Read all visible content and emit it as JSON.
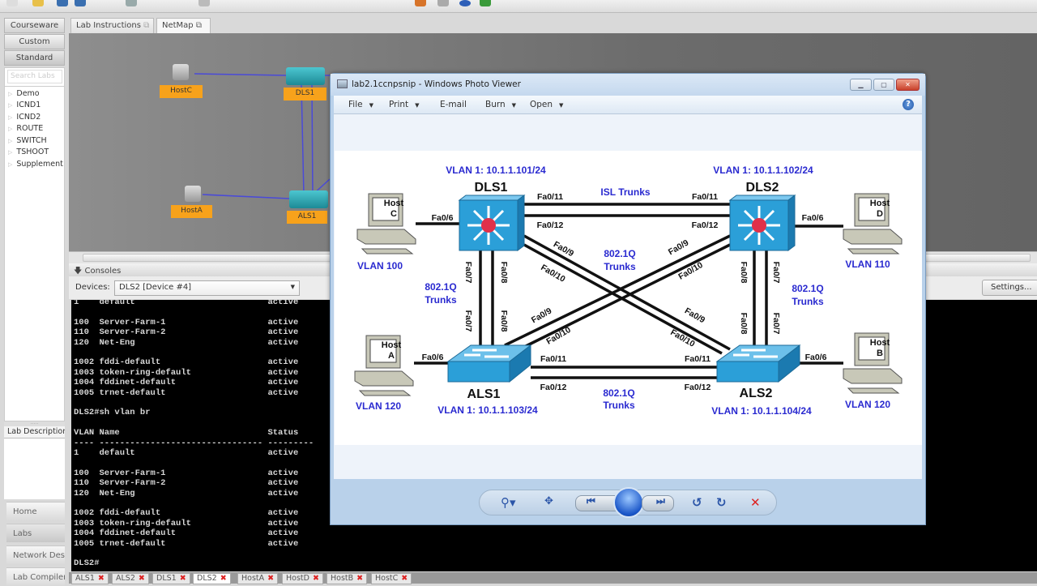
{
  "left_panel": {
    "buttons": [
      "Courseware",
      "Custom",
      "Standard"
    ],
    "search_placeholder": "Search Labs",
    "tree": [
      "Demo",
      "ICND1",
      "ICND2",
      "ROUTE",
      "SWITCH",
      "TSHOOT",
      "Supplement"
    ],
    "description_tab": "Lab Description",
    "nav": [
      "Home",
      "Labs",
      "Network Des",
      "Lab Compiler"
    ]
  },
  "main": {
    "tabs": [
      "Lab Instructions",
      "NetMap"
    ],
    "netmap_nodes": [
      "HostC",
      "DLS1",
      "HostA",
      "ALS1"
    ],
    "consoles_label": "Consoles",
    "devices_label": "Devices:",
    "device_selected": "DLS2 [Device #4]",
    "settings_label": "Settings...",
    "terminal_lines": [
      "1    default                          active",
      "",
      "100  Server-Farm-1                    active",
      "110  Server-Farm-2                    active",
      "120  Net-Eng                          active",
      "",
      "1002 fddi-default                     active",
      "1003 token-ring-default               active",
      "1004 fddinet-default                  active",
      "1005 trnet-default                    active",
      "",
      "DLS2#sh vlan br",
      "",
      "VLAN Name                             Status",
      "---- -------------------------------- ---------",
      "1    default                          active",
      "",
      "100  Server-Farm-1                    active",
      "110  Server-Farm-2                    active",
      "120  Net-Eng                          active",
      "",
      "1002 fddi-default                     active",
      "1003 token-ring-default               active",
      "1004 fddinet-default                  active",
      "1005 trnet-default                    active",
      "",
      "DLS2#"
    ],
    "console_tabs": [
      {
        "label": "ALS1",
        "active": false
      },
      {
        "label": "ALS2",
        "active": false
      },
      {
        "label": "DLS1",
        "active": false
      },
      {
        "label": "DLS2",
        "active": true
      },
      {
        "label": "HostA",
        "active": false
      },
      {
        "label": "HostD",
        "active": false
      },
      {
        "label": "HostB",
        "active": false
      },
      {
        "label": "HostC",
        "active": false
      }
    ]
  },
  "photo_viewer": {
    "title": "lab2.1ccnpsnip - Windows Photo Viewer",
    "menu": [
      {
        "label": "File",
        "dropdown": true
      },
      {
        "label": "Print",
        "dropdown": true
      },
      {
        "label": "E-mail",
        "dropdown": false
      },
      {
        "label": "Burn",
        "dropdown": true
      },
      {
        "label": "Open",
        "dropdown": true
      }
    ],
    "diagram": {
      "dls1": {
        "name": "DLS1",
        "ip": "VLAN 1: 10.1.1.101/24"
      },
      "dls2": {
        "name": "DLS2",
        "ip": "VLAN 1: 10.1.1.102/24"
      },
      "als1": {
        "name": "ALS1",
        "ip": "VLAN 1: 10.1.1.103/24"
      },
      "als2": {
        "name": "ALS2",
        "ip": "VLAN 1: 10.1.1.104/24"
      },
      "hosts": [
        {
          "name": "Host",
          "letter": "C",
          "vlan": "VLAN 100"
        },
        {
          "name": "Host",
          "letter": "D",
          "vlan": "VLAN 110"
        },
        {
          "name": "Host",
          "letter": "A",
          "vlan": "VLAN 120"
        },
        {
          "name": "Host",
          "letter": "B",
          "vlan": "VLAN 120"
        }
      ],
      "isl_trunks": "ISL Trunks",
      "dot1q": "802.1Q",
      "trunks": "Trunks",
      "ports": {
        "fa6": "Fa0/6",
        "fa7": "Fa0/7",
        "fa8": "Fa0/8",
        "fa9": "Fa0/9",
        "fa10": "Fa0/10",
        "fa11": "Fa0/11",
        "fa12": "Fa0/12"
      },
      "colors": {
        "label_blue": "#2a2ad0",
        "switch": "#2b9fd8",
        "router_dot": "#e0304a"
      }
    }
  }
}
